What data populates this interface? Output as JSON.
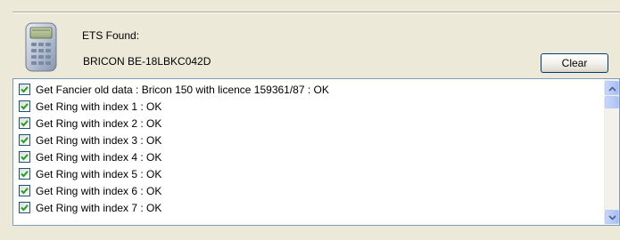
{
  "header": {
    "ets_found_label": "ETS Found:",
    "device_name": "BRICON BE-18LBKC042D",
    "device_icon": "handheld-device-icon"
  },
  "toolbar": {
    "clear_label": "Clear"
  },
  "log": {
    "items": [
      {
        "label": "Get Fancier old data : Bricon 150 with licence 159361/87 : OK",
        "checked": true
      },
      {
        "label": "Get Ring with index 1 : OK",
        "checked": true
      },
      {
        "label": "Get Ring with index 2 : OK",
        "checked": true
      },
      {
        "label": "Get Ring with index 3 : OK",
        "checked": true
      },
      {
        "label": "Get Ring with index 4 : OK",
        "checked": true
      },
      {
        "label": "Get Ring with index 5 : OK",
        "checked": true
      },
      {
        "label": "Get Ring with index 6 : OK",
        "checked": true
      },
      {
        "label": "Get Ring with index 7 : OK",
        "checked": true
      }
    ]
  },
  "colors": {
    "window_bg": "#ece9d8",
    "list_border": "#7f9db9",
    "check_green": "#21a121",
    "button_border": "#003c74"
  }
}
